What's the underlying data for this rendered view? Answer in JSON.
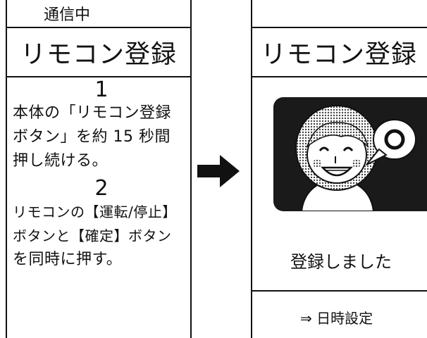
{
  "left_screen": {
    "status": "通信中",
    "title": "リモコン登録",
    "step1": {
      "number": "1",
      "lines": [
        "本体の「リモコン登録",
        "ボタン」を約 15 秒間",
        "押し続ける。"
      ]
    },
    "step2": {
      "number": "2",
      "lines": [
        "リモコンの【運転/停止】",
        "ボタンと【確定】ボタン",
        "を同時に押す。"
      ]
    }
  },
  "right_screen": {
    "title": "リモコン登録",
    "message": "登録しました",
    "next": "⇒ 日時設定"
  },
  "colors": {
    "ink": "#111111",
    "background": "#ffffff",
    "image_bg": "#1a1a1a"
  },
  "icons": {
    "transition_arrow": "right-arrow-icon",
    "confirmation_illustration": "smiling-person-ok-bubble"
  }
}
